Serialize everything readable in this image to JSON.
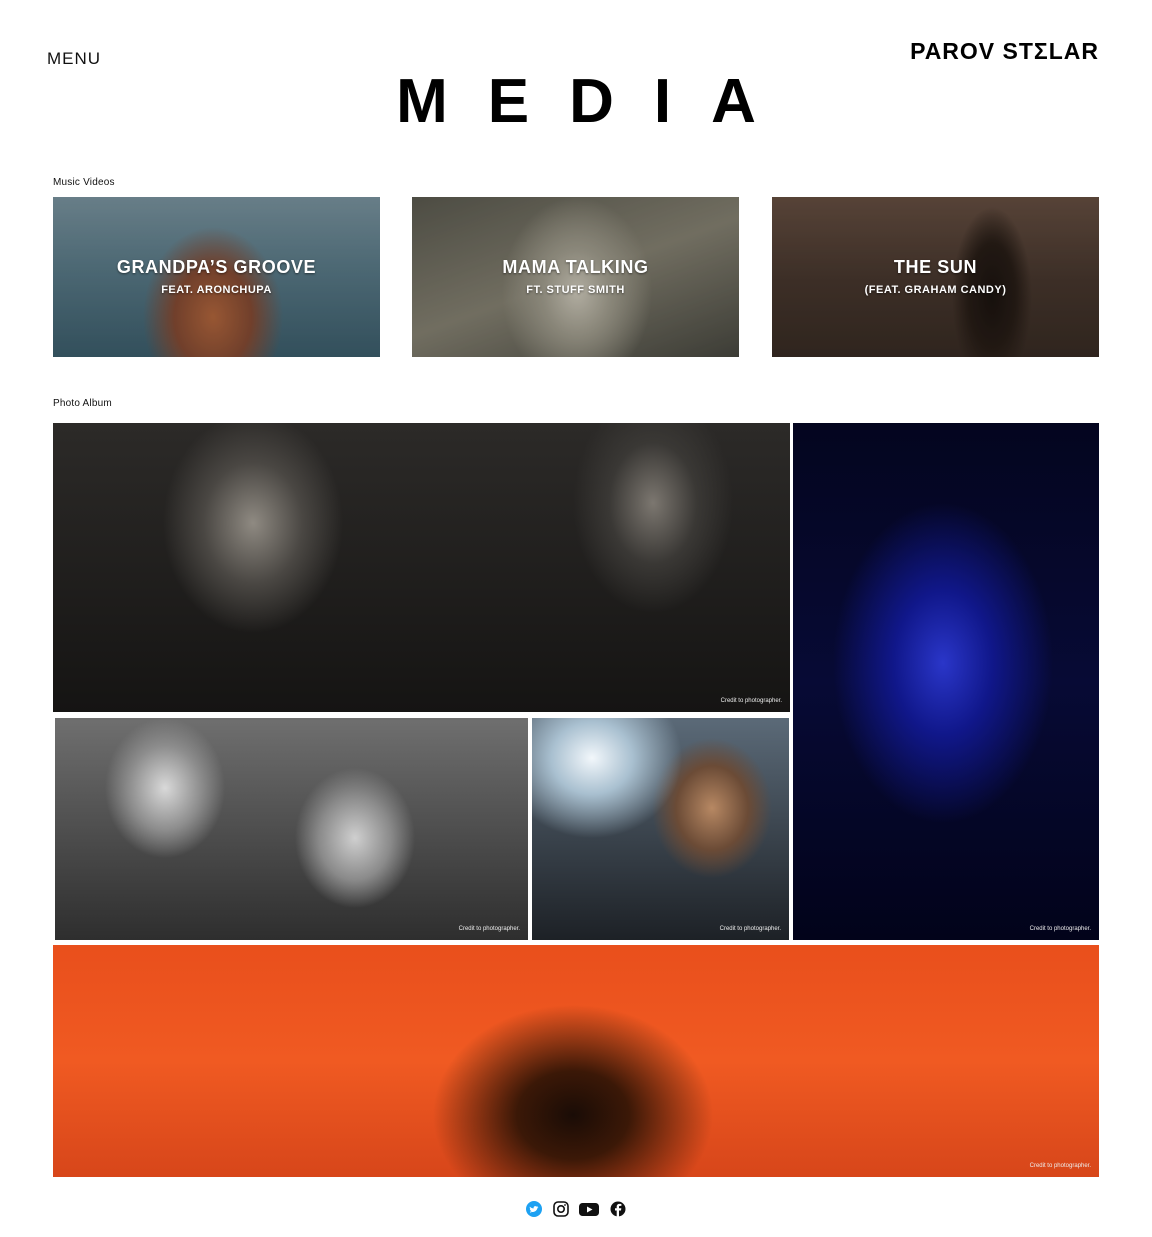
{
  "header": {
    "menu_label": "MENU",
    "logo_text": "PAROV STΣLAR",
    "page_title": "MEDIA"
  },
  "music_videos": {
    "label": "Music Videos",
    "items": [
      {
        "title": "GRANDPA’S GROOVE",
        "subtitle": "FEAT. ARONCHUPA"
      },
      {
        "title": "MAMA TALKING",
        "subtitle": "FT. STUFF SMITH"
      },
      {
        "title": "THE SUN",
        "subtitle": "(FEAT. GRAHAM CANDY)"
      }
    ]
  },
  "photo_album": {
    "label": "Photo Album",
    "credit_text": "Credit to photographer."
  },
  "social": {
    "icons": [
      "twitter-icon",
      "instagram-icon",
      "youtube-icon",
      "facebook-icon"
    ],
    "twitter_color": "#1da1f2"
  }
}
